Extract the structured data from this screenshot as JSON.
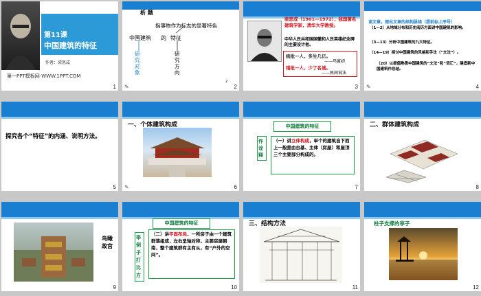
{
  "slides": [
    {
      "num": "1",
      "title_line1": "第11课",
      "title_line2": "中国建筑的特征",
      "author": "作者：梁思成",
      "site": "第一PPT模板网-WWW.1PPT.COM"
    },
    {
      "num": "2",
      "heading": "析 题",
      "line1": "指事物作为标志的显著特色",
      "label_a": "中国建筑",
      "label_b": "的",
      "label_c": "特征",
      "v1": "研究对象",
      "v2": "研究方向",
      "page_corner": "2"
    },
    {
      "num": "3",
      "bio": "梁思成（1901—1972），我国著名建筑学家，清华大学教授。",
      "bio2": "中华人民共和国国徽和人民英雄纪念碑的主要设计者。",
      "quote1": "梳批一人，多生几亿。",
      "quote1_by": "——马寅初",
      "quote2": "错批一人，少了名城。",
      "quote2_by": "——民间说法"
    },
    {
      "num": "4",
      "head": "读文章，理出文章的结构脉络（提前标上序号）",
      "i1": "（1—2）从地域分布和历史阅历方面讲中国建筑的影响。",
      "i2": "（3—13）分析中国建筑的九大特征。",
      "i3": "（14—19）探讨中国建筑的风格和手法（“文法”）。",
      "i4": "（20）以提倡熟悉中国建筑的“文法”和“词汇”，建造新中国建筑作总结。"
    },
    {
      "num": "5",
      "text": "探究各个“特征”的内涵、说明方法。"
    },
    {
      "num": "6",
      "heading": "一、个体建筑构成"
    },
    {
      "num": "7",
      "box_title": "中国建筑的特征",
      "side": "作诠释",
      "body_pre": "（一）讲",
      "body_hl": "立体构成",
      "body_post": "，单个的建筑自下而上一般是由台基、主体（房屋）和屋顶三个主要部分构成的。"
    },
    {
      "num": "8",
      "heading": "二、群体建筑构成"
    },
    {
      "num": "9",
      "caption": "鸟瞰故宫"
    },
    {
      "num": "10",
      "box_title": "中国建筑的特征",
      "side": "举例子打比方",
      "body_pre": "（二）讲",
      "body_hl": "平面布局",
      "body_post": "，一所房子由一个建筑群落组成，左右呈轴对称，主要房屋朝南，整个建筑群有主有从，有“户外的空间”。"
    },
    {
      "num": "11",
      "heading": "三、结构方法"
    },
    {
      "num": "12",
      "banner": "柱子支撑的亭子"
    }
  ],
  "colors": {
    "blue": "#1a7fd0",
    "green": "#1aa14a",
    "red": "#d0141c",
    "bg": "#c8c8c8"
  }
}
